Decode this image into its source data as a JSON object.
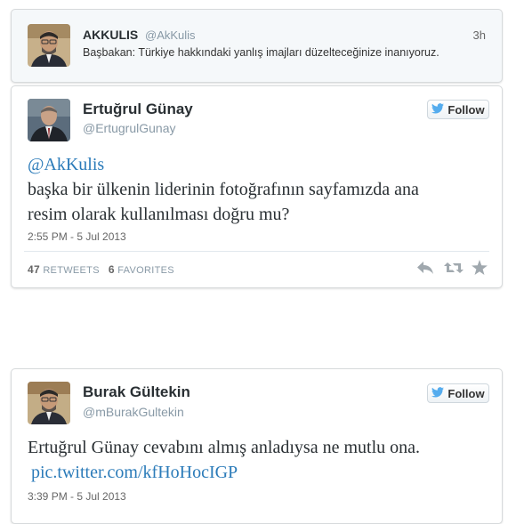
{
  "top_tweet": {
    "name": "AKKULIS",
    "handle": "@AkKulis",
    "time": "3h",
    "text": "Başbakan: Türkiye hakkındaki yanlış imajları düzelteceğinize inanıyoruz."
  },
  "main_tweet": {
    "name": "Ertuğrul Günay",
    "handle": "@ErtugrulGunay",
    "follow_label": "Follow",
    "mention": "@AkKulis",
    "text_line1": "başka bir ülkenin liderinin fotoğrafının sayfamızda ana",
    "text_line2": "resim olarak kullanılması doğru mu?",
    "timestamp": "2:55 PM - 5 Jul 2013",
    "retweets_count": "47",
    "retweets_label": "RETWEETS",
    "favorites_count": "6",
    "favorites_label": "FAVORITES"
  },
  "bottom_tweet": {
    "name": "Burak Gültekin",
    "handle": "@mBurakGultekin",
    "follow_label": "Follow",
    "text": "Ertuğrul Günay cevabını almış anladıysa ne mutlu ona.",
    "link": "pic.twitter.com/kfHoHocIGP",
    "timestamp": "3:39 PM - 5 Jul 2013"
  },
  "icons": {
    "reply": "reply-icon",
    "retweet": "retweet-icon",
    "favorite": "star-icon",
    "bird": "twitter-bird-icon"
  },
  "colors": {
    "link": "#2b7bb9",
    "twitter_blue": "#55acee"
  }
}
